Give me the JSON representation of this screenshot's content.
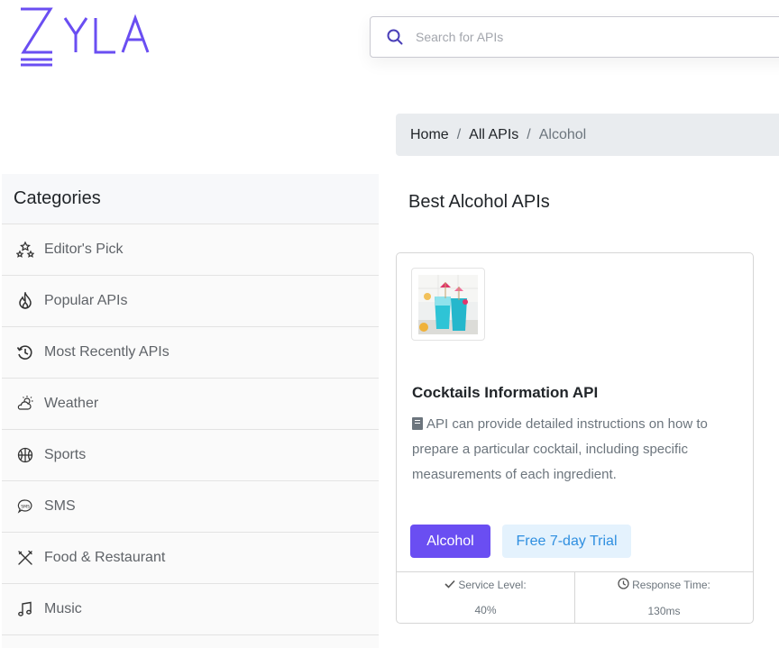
{
  "brand": {
    "logo_text": "ZYLA",
    "accent": "#6a4ef2"
  },
  "search": {
    "placeholder": "Search for APIs",
    "icon": "search-icon"
  },
  "breadcrumb": {
    "home": "Home",
    "all": "All APIs",
    "current": "Alcohol",
    "separator": "/"
  },
  "sidebar": {
    "title": "Categories",
    "items": [
      {
        "label": "Editor's Pick",
        "icon": "stars-icon"
      },
      {
        "label": "Popular APIs",
        "icon": "fire-icon"
      },
      {
        "label": "Most Recently APIs",
        "icon": "history-icon"
      },
      {
        "label": "Weather",
        "icon": "cloud-sun-icon"
      },
      {
        "label": "Sports",
        "icon": "basketball-icon"
      },
      {
        "label": "SMS",
        "icon": "sms-icon"
      },
      {
        "label": "Food & Restaurant",
        "icon": "fork-knife-icon"
      },
      {
        "label": "Music",
        "icon": "music-note-icon"
      }
    ]
  },
  "main": {
    "title": "Best Alcohol APIs"
  },
  "card": {
    "name": "Cocktails Information API",
    "description": "API can provide detailed instructions on how to prepare a particular cocktail, including specific measurements of each ingredient.",
    "category_button": "Alcohol",
    "trial_button": "Free 7-day Trial",
    "service_level_label": "Service Level:",
    "service_level_value": "40%",
    "response_time_label": "Response Time:",
    "response_time_value": "130ms"
  }
}
